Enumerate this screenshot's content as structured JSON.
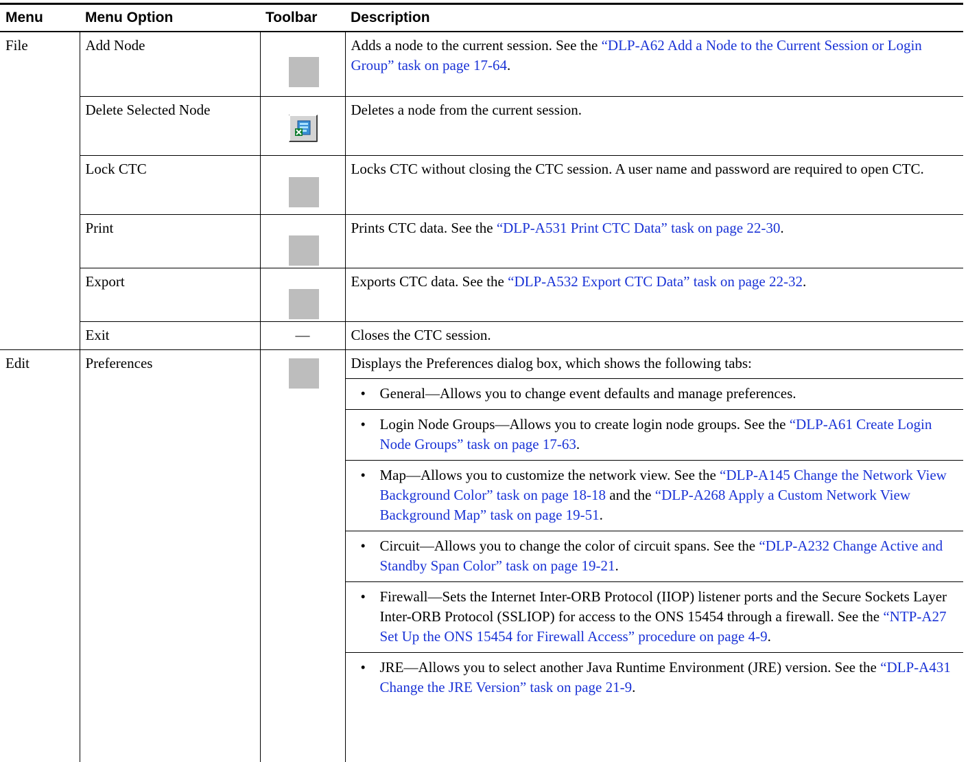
{
  "headers": [
    "Menu",
    "Menu Option",
    "Toolbar",
    "Description"
  ],
  "toolbar_dash": "—",
  "file": {
    "menu": "File",
    "rows": [
      {
        "option": "Add Node",
        "toolbar": "gray",
        "desc_pre": "Adds a node to the current session. See the ",
        "link": "“DLP-A62 Add a Node to the Current Session or Login Group” task on page 17-64",
        "desc_post": "."
      },
      {
        "option": "Delete Selected Node",
        "toolbar": "delete-node-icon",
        "desc_pre": "Deletes a node from the current session.",
        "link": "",
        "desc_post": ""
      },
      {
        "option": "Lock CTC",
        "toolbar": "gray",
        "desc_pre": "Locks CTC without closing the CTC session. A user name and password are required to open CTC.",
        "link": "",
        "desc_post": ""
      },
      {
        "option": "Print",
        "toolbar": "gray",
        "desc_pre": "Prints CTC data. See the ",
        "link": "“DLP-A531 Print CTC Data” task on page 22-30",
        "desc_post": "."
      },
      {
        "option": "Export",
        "toolbar": "gray",
        "desc_pre": "Exports CTC data. See the ",
        "link": "“DLP-A532 Export CTC Data” task on page 22-32",
        "desc_post": "."
      },
      {
        "option": "Exit",
        "toolbar": "dash",
        "desc_pre": "Closes the CTC session.",
        "link": "",
        "desc_post": ""
      }
    ]
  },
  "edit": {
    "menu": "Edit",
    "option": "Preferences",
    "intro": "Displays the Preferences dialog box, which shows the following tabs:",
    "bullet": "•",
    "bullets": [
      {
        "pre": "General—Allows you to change event defaults and manage preferences.",
        "link": "",
        "mid": "",
        "link2": "",
        "post": ""
      },
      {
        "pre": "Login Node Groups—Allows you to create login node groups. See the ",
        "link": "“DLP-A61 Create Login Node Groups” task on page 17-63",
        "mid": "",
        "link2": "",
        "post": "."
      },
      {
        "pre": "Map—Allows you to customize the network view. See the ",
        "link": "“DLP-A145 Change the Network View Background Color” task on page 18-18",
        "mid": " and the ",
        "link2": "“DLP-A268 Apply a Custom Network View Background Map” task on page 19-51",
        "post": "."
      },
      {
        "pre": "Circuit—Allows you to change the color of circuit spans. See the ",
        "link": "“DLP-A232 Change Active and Standby Span Color” task on page 19-21",
        "mid": "",
        "link2": "",
        "post": "."
      },
      {
        "pre": "Firewall—Sets the Internet Inter-ORB Protocol (IIOP) listener ports and the Secure Sockets Layer Inter-ORB Protocol (SSLIOP) for access to the ONS 15454 through a firewall. See the ",
        "link": "“NTP-A27 Set Up the ONS 15454 for Firewall Access” procedure on page 4-9",
        "mid": "",
        "link2": "",
        "post": "."
      },
      {
        "pre": "JRE—Allows you to select another Java Runtime Environment (JRE) version. See the ",
        "link": "“DLP-A431 Change the JRE Version” task on page 21-9",
        "mid": "",
        "link2": "",
        "post": "."
      }
    ]
  }
}
